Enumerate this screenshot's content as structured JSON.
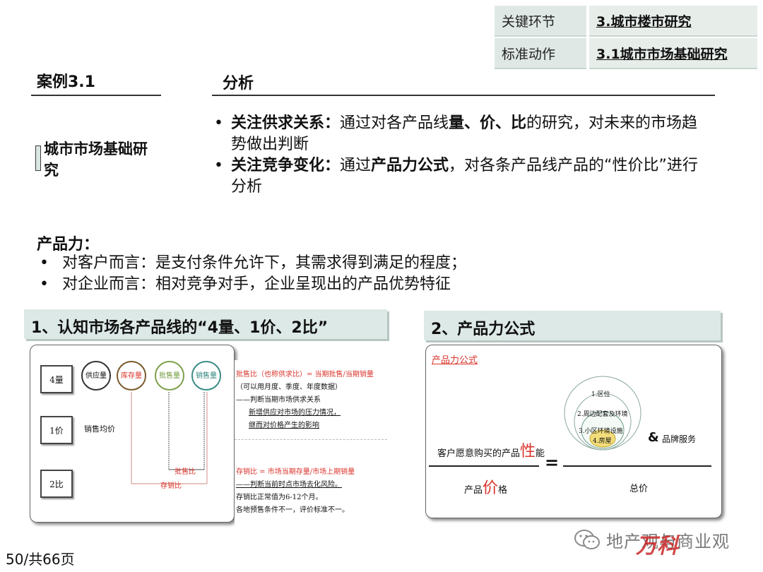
{
  "header": {
    "rows": [
      {
        "key": "关键环节",
        "value": "3.城市楼市研究"
      },
      {
        "key": "标准动作",
        "value": "3.1城市市场基础研究"
      }
    ]
  },
  "case_title": "案例3.1",
  "analysis_title": "分析",
  "side_title": "城市市场基础研究",
  "bullets": [
    {
      "dot": "•",
      "bold": "关注供求关系：",
      "text1": "通过对各产品线",
      "b2": "量、价、比",
      "text2": "的研究，对未来的市场趋势做出判断"
    },
    {
      "dot": "•",
      "bold": "关注竞争变化：",
      "text1": "通过",
      "b2": "产品力公式",
      "text2": "，对各条产品线产品的“性价比”进行分析"
    }
  ],
  "product_power": {
    "title": "产品力：",
    "items": [
      {
        "dot": "•",
        "text": "对客户而言：是支付条件允许下，其需求得到满足的程度；"
      },
      {
        "dot": "•",
        "text": "对企业而言：相对竞争对手，企业呈现出的产品优势特征"
      }
    ]
  },
  "banner1": "1、认知市场各产品线的“4量、1价、2比”",
  "banner2": "2、产品力公式",
  "diagram1": {
    "boxes": [
      "4量",
      "1价",
      "2比"
    ],
    "circles": [
      "供应量",
      "库存量",
      "批售量",
      "销售量"
    ],
    "price_label": "销售均价",
    "ratio1_label": "批售比",
    "ratio2_label": "存销比",
    "notes_top": [
      "批售比（也称供求比）= 当期批售/当期销量",
      "（可以用月度、季度、年度数据）",
      "——判断当期市场供求关系",
      "新增供应对市场的压力情况，",
      "继而对价格产生的影响"
    ],
    "notes_bottom": [
      "存销比 = 市场当期存量/市场上期销量",
      "——判断当前时点市场去化风险。",
      "存销比正常值为6-12个月。",
      "各地预售条件不一，评价标准不一。"
    ]
  },
  "diagram2": {
    "title": "产品力公式",
    "num_prefix": "客户愿意购买的产品",
    "num_big": "性",
    "num_suffix": "能",
    "den_prefix": "产品",
    "den_big": "价",
    "den_suffix": "格",
    "equals": "=",
    "rings": [
      "1.区位",
      "2.周边配套及环境",
      "3.小区环境设施",
      "4.房屋"
    ],
    "amp": "&",
    "brand": "品牌服务",
    "total": "总价"
  },
  "footer": {
    "page": "50/共66页",
    "watermark": "地产观与商业观",
    "logo_text": "万科"
  },
  "colors": {
    "banner_bg": "#dce9e6",
    "header_bg": "#e7eeea",
    "accent_red": "#d9342b"
  }
}
